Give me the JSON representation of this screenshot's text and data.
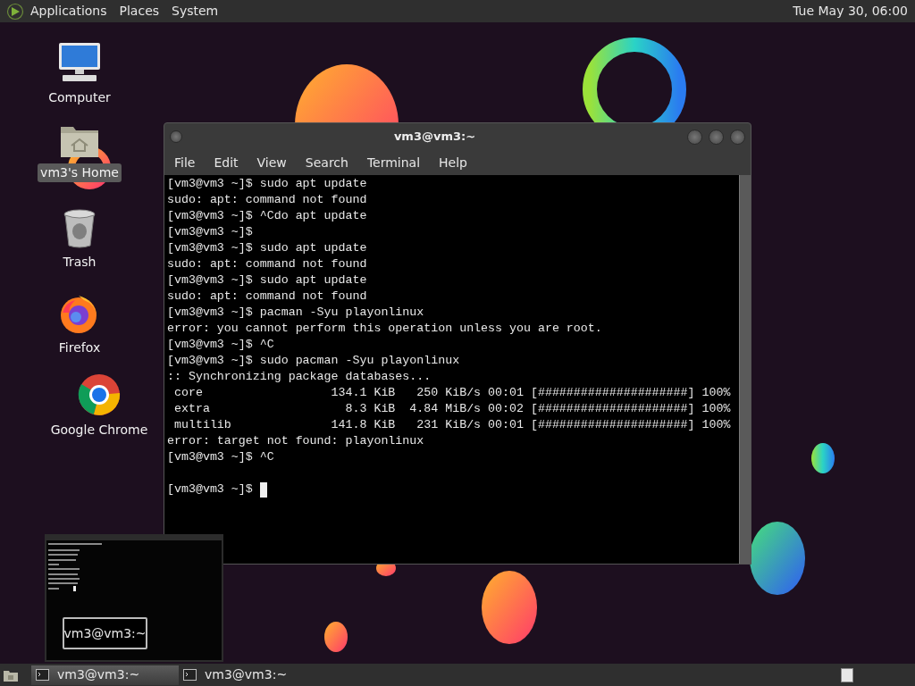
{
  "top_panel": {
    "menus": [
      "Applications",
      "Places",
      "System"
    ],
    "clock": "Tue May 30, 06:00"
  },
  "desktop_icons": [
    {
      "kind": "computer",
      "label": "Computer",
      "selected": false
    },
    {
      "kind": "home",
      "label": "vm3's Home",
      "selected": true
    },
    {
      "kind": "trash",
      "label": "Trash",
      "selected": false
    },
    {
      "kind": "firefox",
      "label": "Firefox",
      "selected": false
    },
    {
      "kind": "chrome",
      "label": "Google Chrome",
      "selected": false
    }
  ],
  "terminal": {
    "title": "vm3@vm3:~",
    "menu": [
      "File",
      "Edit",
      "View",
      "Search",
      "Terminal",
      "Help"
    ],
    "lines": [
      "[vm3@vm3 ~]$ sudo apt update",
      "sudo: apt: command not found",
      "[vm3@vm3 ~]$ ^Cdo apt update",
      "[vm3@vm3 ~]$",
      "[vm3@vm3 ~]$ sudo apt update",
      "sudo: apt: command not found",
      "[vm3@vm3 ~]$ sudo apt update",
      "sudo: apt: command not found",
      "[vm3@vm3 ~]$ pacman -Syu playonlinux",
      "error: you cannot perform this operation unless you are root.",
      "[vm3@vm3 ~]$ ^C",
      "[vm3@vm3 ~]$ sudo pacman -Syu playonlinux",
      ":: Synchronizing package databases...",
      " core                  134.1 KiB   250 KiB/s 00:01 [#####################] 100%",
      " extra                   8.3 KiB  4.84 MiB/s 00:02 [#####################] 100%",
      " multilib              141.8 KiB   231 KiB/s 00:01 [#####################] 100%",
      "error: target not found: playonlinux",
      "[vm3@vm3 ~]$ ^C"
    ],
    "prompt": "[vm3@vm3 ~]$",
    "cursor": true
  },
  "preview_tooltip": "vm3@vm3:~",
  "taskbar": {
    "tasks": [
      {
        "label": "vm3@vm3:~",
        "selected": true
      },
      {
        "label": "vm3@vm3:~",
        "selected": false
      }
    ]
  }
}
